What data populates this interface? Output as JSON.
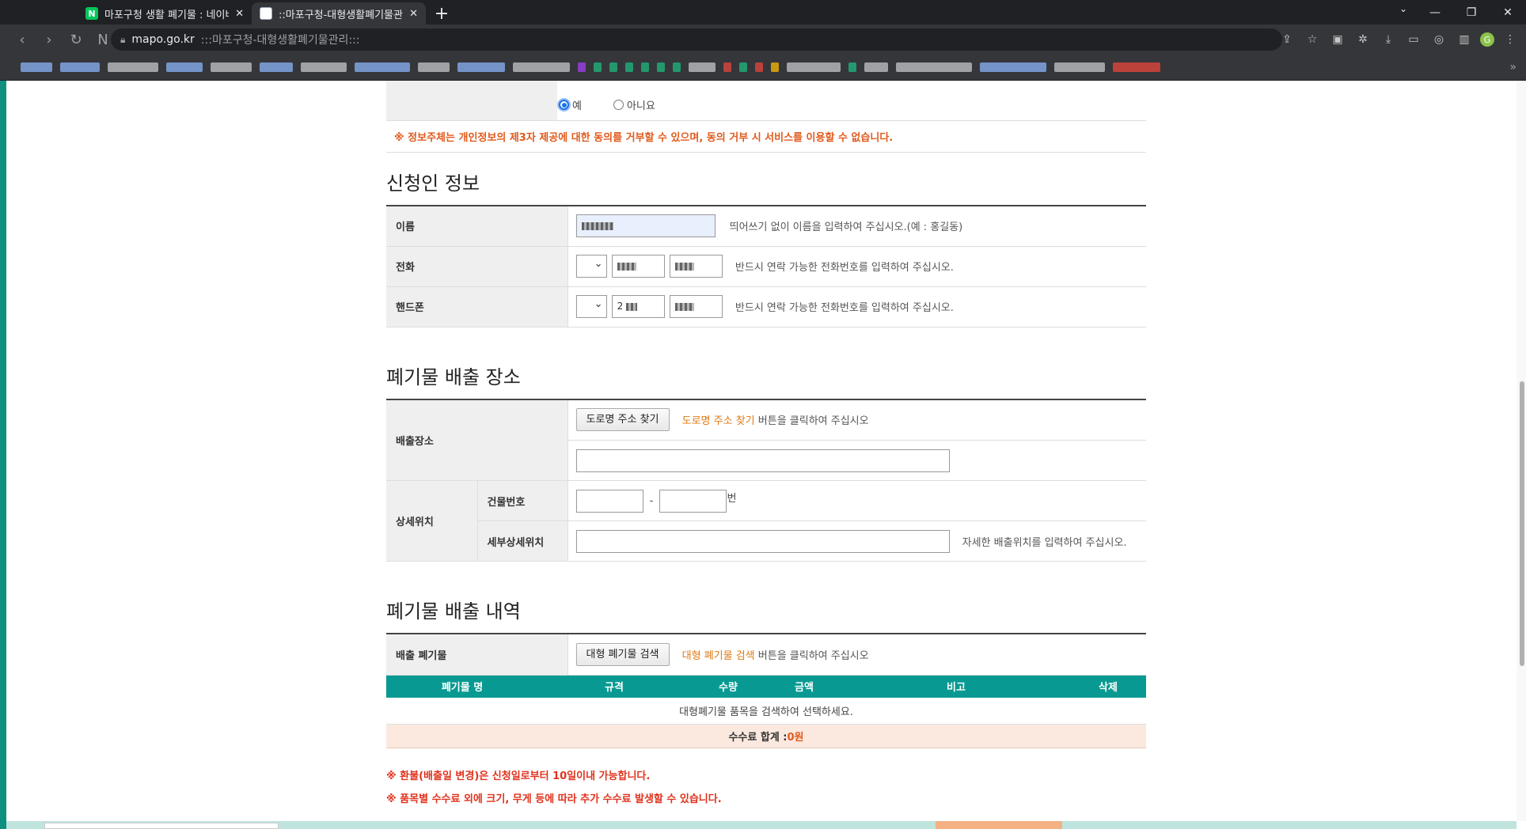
{
  "browser": {
    "tabs": [
      {
        "title": "마포구청 생활 폐기물 : 네이버 ...",
        "favicon": "naver-icon",
        "active": false
      },
      {
        "title": "::마포구청-대형생활폐기물관리::",
        "favicon": "mapo-icon",
        "active": true
      }
    ],
    "new_tab": "+",
    "naver_letter": "N",
    "address": {
      "domain": "mapo.go.kr",
      "title": ":::마포구청-대형생활폐기물관리:::"
    },
    "bookmarks_more": "»",
    "profile_letter": "G"
  },
  "consent": {
    "yes_label": "예",
    "no_label": "아니요",
    "selected": "yes",
    "notice": "※ 정보주체는 개인정보의 제3자 제공에 대한 동의를 거부할 수 있으며, 동의 거부 시 서비스를 이용할 수 없습니다."
  },
  "applicant": {
    "title": "신청인 정보",
    "name_label": "이름",
    "name_hint": "띄어쓰기 없이 이름을 입력하여 주십시오.(예 : 홍길동)",
    "phone_label": "전화",
    "phone_hint": "반드시 연락 가능한 전화번호를 입력하여 주십시오.",
    "mobile_label": "핸드폰",
    "mobile_middle_prefix": "2",
    "mobile_hint": "반드시 연락 가능한 전화번호를 입력하여 주십시오."
  },
  "location": {
    "title": "폐기물 배출 장소",
    "place_label": "배출장소",
    "road_button": "도로명 주소 찾기",
    "road_hint_highlight": "도로명 주소 찾기",
    "road_hint_rest": " 버튼을 클릭하여 주십시오",
    "detail_label": "상세위치",
    "building_label": "건물번호",
    "building_dash": "-",
    "building_suffix": "번",
    "sub_detail_label": "세부상세위치",
    "sub_detail_hint": "자세한 배출위치를 입력하여 주십시오."
  },
  "waste": {
    "title": "폐기물 배출 내역",
    "item_label": "배출 폐기물",
    "search_button": "대형 폐기물 검색",
    "search_hint_highlight": "대형 폐기물 검색",
    "search_hint_rest": " 버튼을 클릭하여 주십시오",
    "columns": [
      "폐기물 명",
      "규격",
      "수량",
      "금액",
      "비고",
      "삭제"
    ],
    "empty_message": "대형폐기물 품목을 검색하여 선택하세요.",
    "total_label": "수수료 합계 : ",
    "total_amount": "0원"
  },
  "notes": [
    "※ 환불(배출일 변경)은 신청일로부터 10일이내 가능합니다.",
    "※ 품목별 수수료 외에 크기, 무게 등에 따라 추가 수수료 발생할 수 있습니다."
  ],
  "colors": {
    "accent": "#089a92",
    "notice": "#e05a1c",
    "highlight": "#e07a14"
  }
}
